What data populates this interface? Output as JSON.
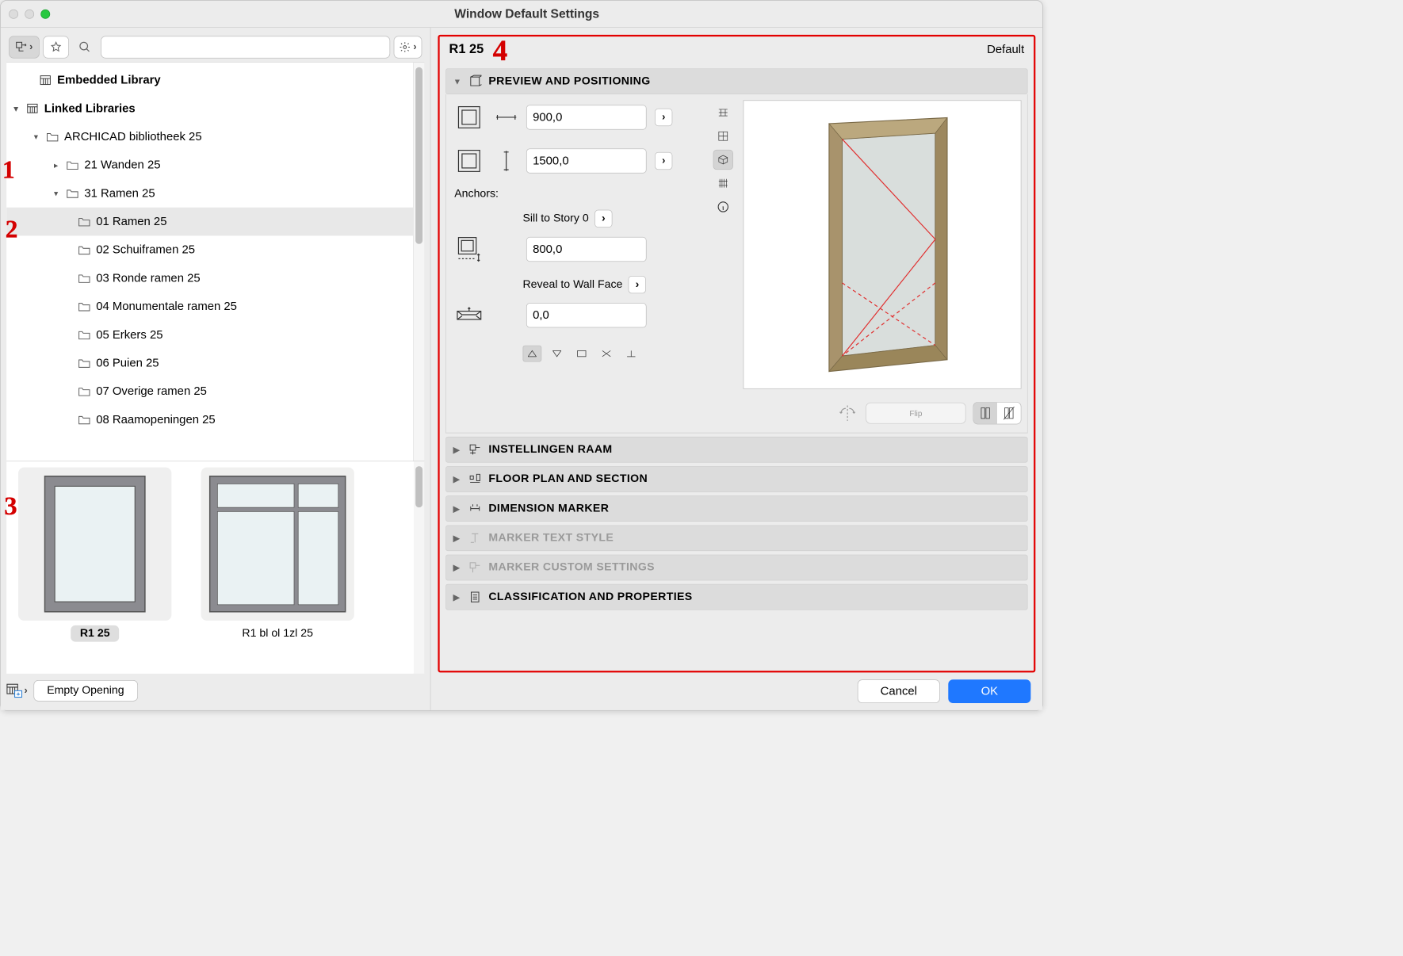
{
  "window": {
    "title": "Window Default Settings"
  },
  "annotations": {
    "one": "1",
    "two": "2",
    "three": "3",
    "four": "4"
  },
  "search": {
    "placeholder": ""
  },
  "tree": {
    "embedded": "Embedded Library",
    "linked": "Linked Libraries",
    "root": "ARCHICAD bibliotheek 25",
    "sub1": "21 Wanden 25",
    "sub2": "31 Ramen 25",
    "items": [
      "01 Ramen 25",
      "02 Schuiframen 25",
      "03 Ronde ramen 25",
      "04 Monumentale ramen 25",
      "05 Erkers 25",
      "06 Puien 25",
      "07 Overige ramen 25",
      "08 Raamopeningen 25"
    ]
  },
  "thumbs": {
    "a": "R1 25",
    "b": "R1 bl ol 1zl 25"
  },
  "leftbottom": {
    "empty": "Empty Opening"
  },
  "right": {
    "title": "R1 25",
    "default": "Default",
    "panels": {
      "preview": "PREVIEW AND POSITIONING",
      "inst": "INSTELLINGEN RAAM",
      "floor": "FLOOR PLAN AND SECTION",
      "dim": "DIMENSION MARKER",
      "mtext": "MARKER TEXT STYLE",
      "mcust": "MARKER CUSTOM SETTINGS",
      "class": "CLASSIFICATION AND PROPERTIES"
    },
    "pp": {
      "width": "900,0",
      "height": "1500,0",
      "anchors": "Anchors:",
      "sill_label": "Sill to Story 0",
      "sill": "800,0",
      "reveal_label": "Reveal to Wall Face",
      "reveal": "0,0",
      "flip": "Flip"
    }
  },
  "buttons": {
    "cancel": "Cancel",
    "ok": "OK"
  }
}
